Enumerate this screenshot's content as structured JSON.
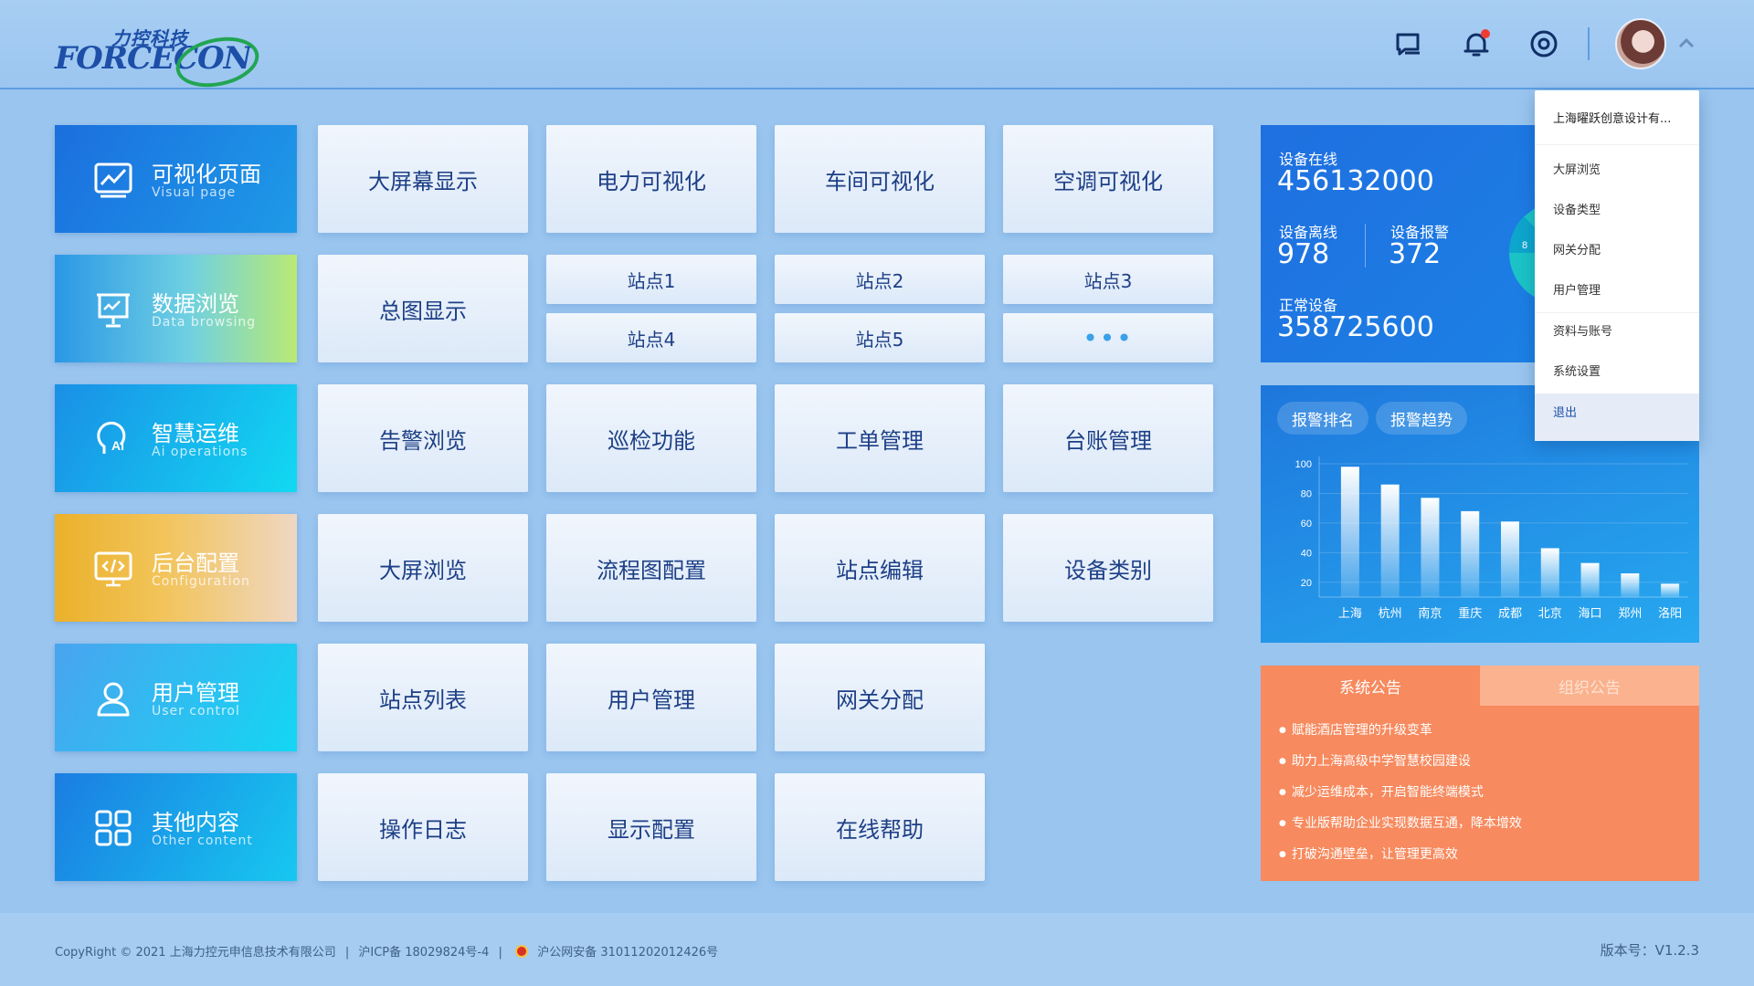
{
  "brand": {
    "cn": "力控科技",
    "en": "FORCECON"
  },
  "header": {
    "icons": [
      "message-icon",
      "bell-icon",
      "settings-icon"
    ],
    "has_notification": true
  },
  "colors": {
    "accent": "#1f6fe0",
    "notice": "#f78a5e",
    "background": "#99c5ef"
  },
  "categories": [
    {
      "title": "可视化页面",
      "sub": "Visual page",
      "icon": "chart-screen-icon"
    },
    {
      "title": "数据浏览",
      "sub": "Data browsing",
      "icon": "presentation-board-icon"
    },
    {
      "title": "智慧运维",
      "sub": "Ai operations",
      "icon": "ai-head-icon"
    },
    {
      "title": "后台配置",
      "sub": "Configuration",
      "icon": "code-screen-icon"
    },
    {
      "title": "用户管理",
      "sub": "User control",
      "icon": "user-icon"
    },
    {
      "title": "其他内容",
      "sub": "Other content",
      "icon": "grid-icon"
    }
  ],
  "rows": {
    "r1": [
      "大屏幕显示",
      "电力可视化",
      "车间可视化",
      "空调可视化"
    ],
    "r2": {
      "main": "总图显示",
      "stations": [
        "站点1",
        "站点2",
        "站点3",
        "站点4",
        "站点5"
      ],
      "more": "•••"
    },
    "r3": [
      "告警浏览",
      "巡检功能",
      "工单管理",
      "台账管理"
    ],
    "r4": [
      "大屏浏览",
      "流程图配置",
      "站点编辑",
      "设备类别"
    ],
    "r5": [
      "站点列表",
      "用户管理",
      "网关分配"
    ],
    "r6": [
      "操作日志",
      "显示配置",
      "在线帮助"
    ]
  },
  "stats": {
    "online_label": "设备在线",
    "online_value": "456132000",
    "offline_label": "设备离线",
    "offline_value": "978",
    "alarm_label": "设备报警",
    "alarm_value": "372",
    "normal_label": "正常设备",
    "normal_value": "358725600",
    "pie_partial_label": "8"
  },
  "chart_panel": {
    "tab1": "报警排名",
    "tab2": "报警趋势"
  },
  "chart_data": {
    "type": "bar",
    "categories": [
      "上海",
      "杭州",
      "南京",
      "重庆",
      "成都",
      "北京",
      "海口",
      "郑州",
      "洛阳"
    ],
    "values": [
      98,
      86,
      77,
      68,
      61,
      43,
      33,
      26,
      19
    ],
    "yticks": [
      20,
      40,
      60,
      80,
      100
    ],
    "ylim": [
      10,
      100
    ],
    "grid": true
  },
  "notice": {
    "tab_active": "系统公告",
    "tab_inactive": "组织公告",
    "items": [
      "赋能酒店管理的升级变革",
      "助力上海高级中学智慧校园建设",
      "减少运维成本，开启智能终端模式",
      "专业版帮助企业实现数据互通，降本增效",
      "打破沟通壁垒，让管理更高效"
    ]
  },
  "dropdown": {
    "company": "上海曜跃创意设计有...",
    "items": [
      "大屏浏览",
      "设备类型",
      "网关分配",
      "用户管理",
      "资料与账号",
      "系统设置",
      "退出"
    ],
    "active_index": 6
  },
  "footer": {
    "copyright": "CopyRight © 2021 上海力控元申信息技术有限公司",
    "icp": "沪ICP备 18029824号-4",
    "police": "沪公网安备 31011202012426号",
    "version": "版本号：V1.2.3"
  }
}
